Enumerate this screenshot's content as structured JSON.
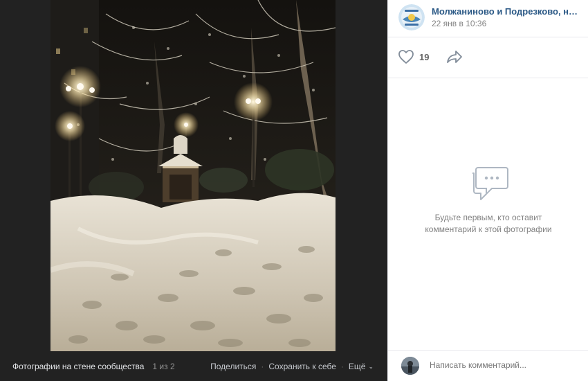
{
  "viewer": {
    "album_title": "Фотографии на стене сообщества",
    "counter": "1 из 2",
    "actions": {
      "share": "Поделиться",
      "save": "Сохранить к себе",
      "more": "Ещё"
    },
    "photo_subject": "snowy-park-night-chapel-photo"
  },
  "post": {
    "author": "Молжаниново и Подрезково, наде…",
    "date": "22 янв в 10:36",
    "likes": "19"
  },
  "comments": {
    "empty_line1": "Будьте первым, кто оставит",
    "empty_line2": "комментарий к этой фотографии",
    "input_placeholder": "Написать комментарий..."
  },
  "colors": {
    "link": "#2a5885",
    "secondary": "#828282",
    "viewer_bg": "#222222"
  }
}
